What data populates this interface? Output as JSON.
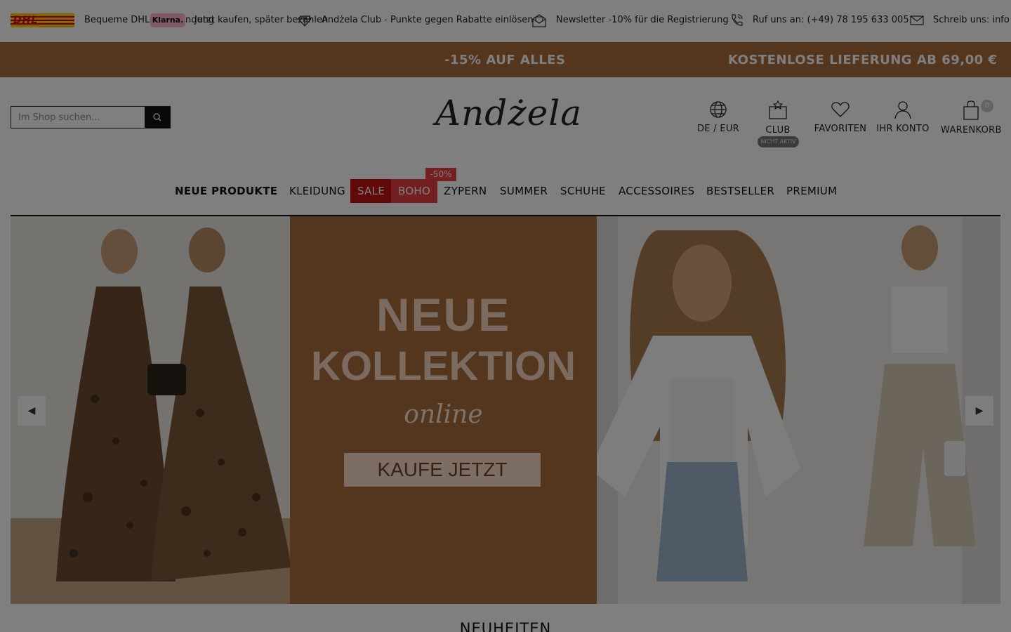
{
  "topbar": {
    "dhl_text": "DHL",
    "item1_text": "Bequeme DHL",
    "klarna_text": "Klarna.",
    "item2_fragment": "ndung",
    "item2_text": "Jetzt kaufen, später bezahlen",
    "item3_text": "Andżela Club - Punkte gegen Rabatte einlösen",
    "item4_text": "Newsletter -10% für die Registrierung",
    "item5_text": "Ruf uns an: (+49) 78 195 633 005",
    "item6_text": "Schreib uns: info",
    "icons": [
      "diamond-icon",
      "newsletter-icon",
      "phone-icon",
      "envelope-icon"
    ]
  },
  "promobar": {
    "left": "-15% AUF ALLES",
    "right": "KOSTENLOSE LIEFERUNG AB 69,00 €",
    "color": "#a86a3c"
  },
  "header": {
    "search_placeholder": "Im Shop suchen...",
    "logo_text": "Andżela",
    "lang_label": "DE / EUR",
    "club_label": "CLUB",
    "club_status": "NICHT AKTIV",
    "favorites_label": "FAVORITEN",
    "account_label": "IHR KONTO",
    "cart_label": "WARENKORB",
    "cart_count": "0"
  },
  "nav": {
    "items": [
      {
        "label": "NEUE PRODUKTE"
      },
      {
        "label": "KLEIDUNG"
      },
      {
        "label": "SALE"
      },
      {
        "label": "BOHO"
      },
      {
        "label": "ZYPERN"
      },
      {
        "label": "SUMMER"
      },
      {
        "label": "SCHUHE"
      },
      {
        "label": "ACCESSOIRES"
      },
      {
        "label": "BESTSELLER"
      },
      {
        "label": "PREMIUM"
      }
    ],
    "boho_badge": "-50%",
    "sale_color": "#c21010",
    "boho_color": "#e84040"
  },
  "hero": {
    "title_line1": "NEUE",
    "title_line2": "KOLLEKTION",
    "subtitle": "online",
    "cta": "KAUFE JETZT",
    "accent": "#a86a3c"
  },
  "section": {
    "title": "NEUHEITEN"
  }
}
